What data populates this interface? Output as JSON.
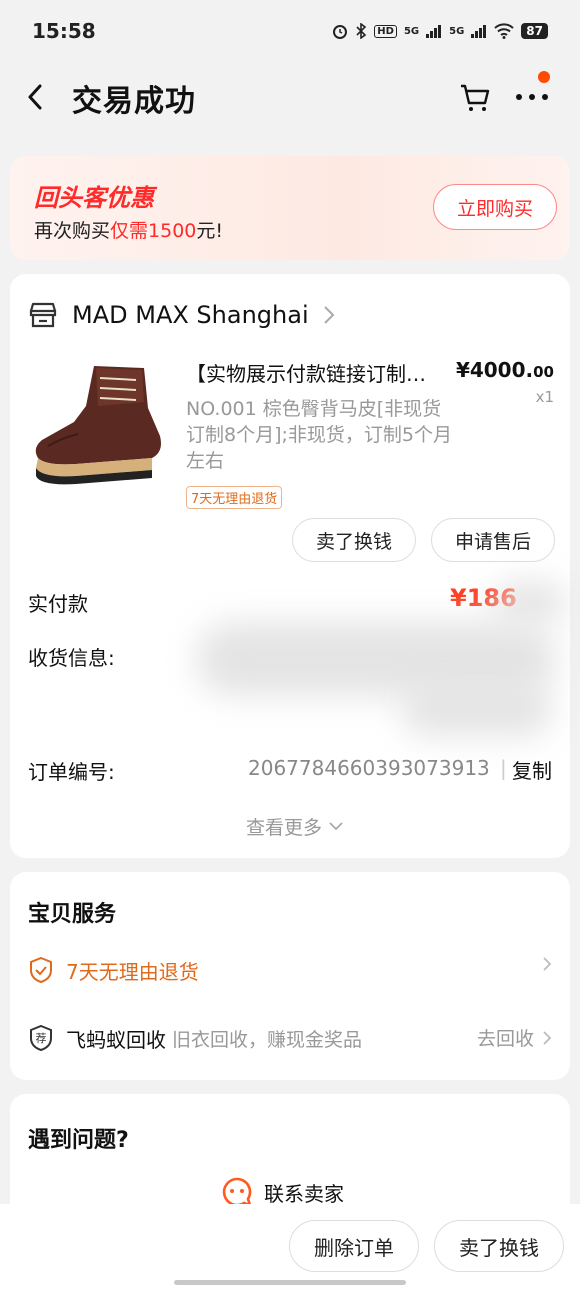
{
  "status_bar": {
    "time": "15:58",
    "network_hd": "HD",
    "network_5g_1": "5G",
    "network_5g_2": "5G",
    "battery": "87"
  },
  "nav": {
    "title": "交易成功"
  },
  "promo": {
    "title": "回头客优惠",
    "sub_prefix": "再次购买",
    "sub_highlight": "仅需1500",
    "sub_suffix": "元!",
    "button": "立即购买"
  },
  "shop": {
    "name": "MAD MAX Shanghai"
  },
  "product": {
    "title": "【实物展示付款链接订制…",
    "price_main": "¥4000.",
    "price_decimal": "00",
    "quantity": "x1",
    "spec": "NO.001 棕色臀背马皮[非现货订制8个月];非现货，订制5个月左右",
    "return_tag": "7天无理由退货"
  },
  "actions": {
    "sell": "卖了换钱",
    "after_sale": "申请售后"
  },
  "order_info": {
    "paid_label": "实付款",
    "paid_value": "¥186",
    "shipping_label": "收货信息:",
    "order_no_label": "订单编号:",
    "order_no": "2067784660393073913",
    "separator": "|",
    "copy": "复制",
    "see_more": "查看更多"
  },
  "services": {
    "title": "宝贝服务",
    "return_policy": "7天无理由退货",
    "recycle_name": "飞蚂蚁回收",
    "recycle_desc": "旧衣回收，赚现金奖品",
    "recycle_action": "去回收"
  },
  "help": {
    "title": "遇到问题?",
    "contact": "联系卖家"
  },
  "bottom": {
    "delete_order": "删除订单",
    "sell": "卖了换钱"
  },
  "colors": {
    "accent_red": "#ff2a2a",
    "price_red": "#ff3b1f",
    "return_orange": "#e06a1c"
  }
}
